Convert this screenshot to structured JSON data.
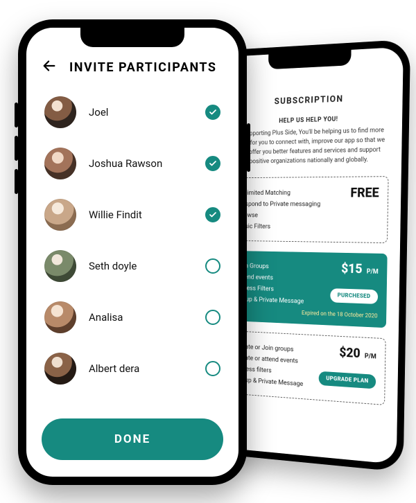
{
  "colors": {
    "accent": "#168a80"
  },
  "front": {
    "title": "INVITE PARTICIPANTS",
    "done_label": "DONE",
    "participants": [
      {
        "name": "Joel",
        "selected": true
      },
      {
        "name": "Joshua Rawson",
        "selected": true
      },
      {
        "name": "Willie Findit",
        "selected": true
      },
      {
        "name": "Seth doyle",
        "selected": false
      },
      {
        "name": "Analisa",
        "selected": false
      },
      {
        "name": "Albert dera",
        "selected": false
      }
    ]
  },
  "back": {
    "title": "SUBSCRIPTION",
    "help_heading": "HELP US HELP YOU!",
    "blurb": "By supporting Plus Side, You'll be helping us to find more users for you to connect with, improve our app so that we can offer you better features and services and support positive organizations nationally and globally.",
    "plans": [
      {
        "price": "FREE",
        "per": "",
        "features": [
          "Unlimited Matching",
          "Respond to Private messaging",
          "Browse",
          "Basic Filters"
        ],
        "cta": null,
        "expiry": null,
        "variant": "outlined"
      },
      {
        "price": "$15",
        "per": "P/M",
        "features": [
          "Join Groups",
          "Attend events",
          "Access Filters",
          "Group & Private Message"
        ],
        "cta": "PURCHESED",
        "expiry": "Expired on the 18 October 2020",
        "variant": "teal"
      },
      {
        "price": "$20",
        "per": "P/M",
        "features": [
          "Create or Join groups",
          "Create or attend events",
          "Access filters",
          "Group & Private Message"
        ],
        "cta": "UPGRADE PLAN",
        "expiry": null,
        "variant": "outlined"
      }
    ]
  }
}
